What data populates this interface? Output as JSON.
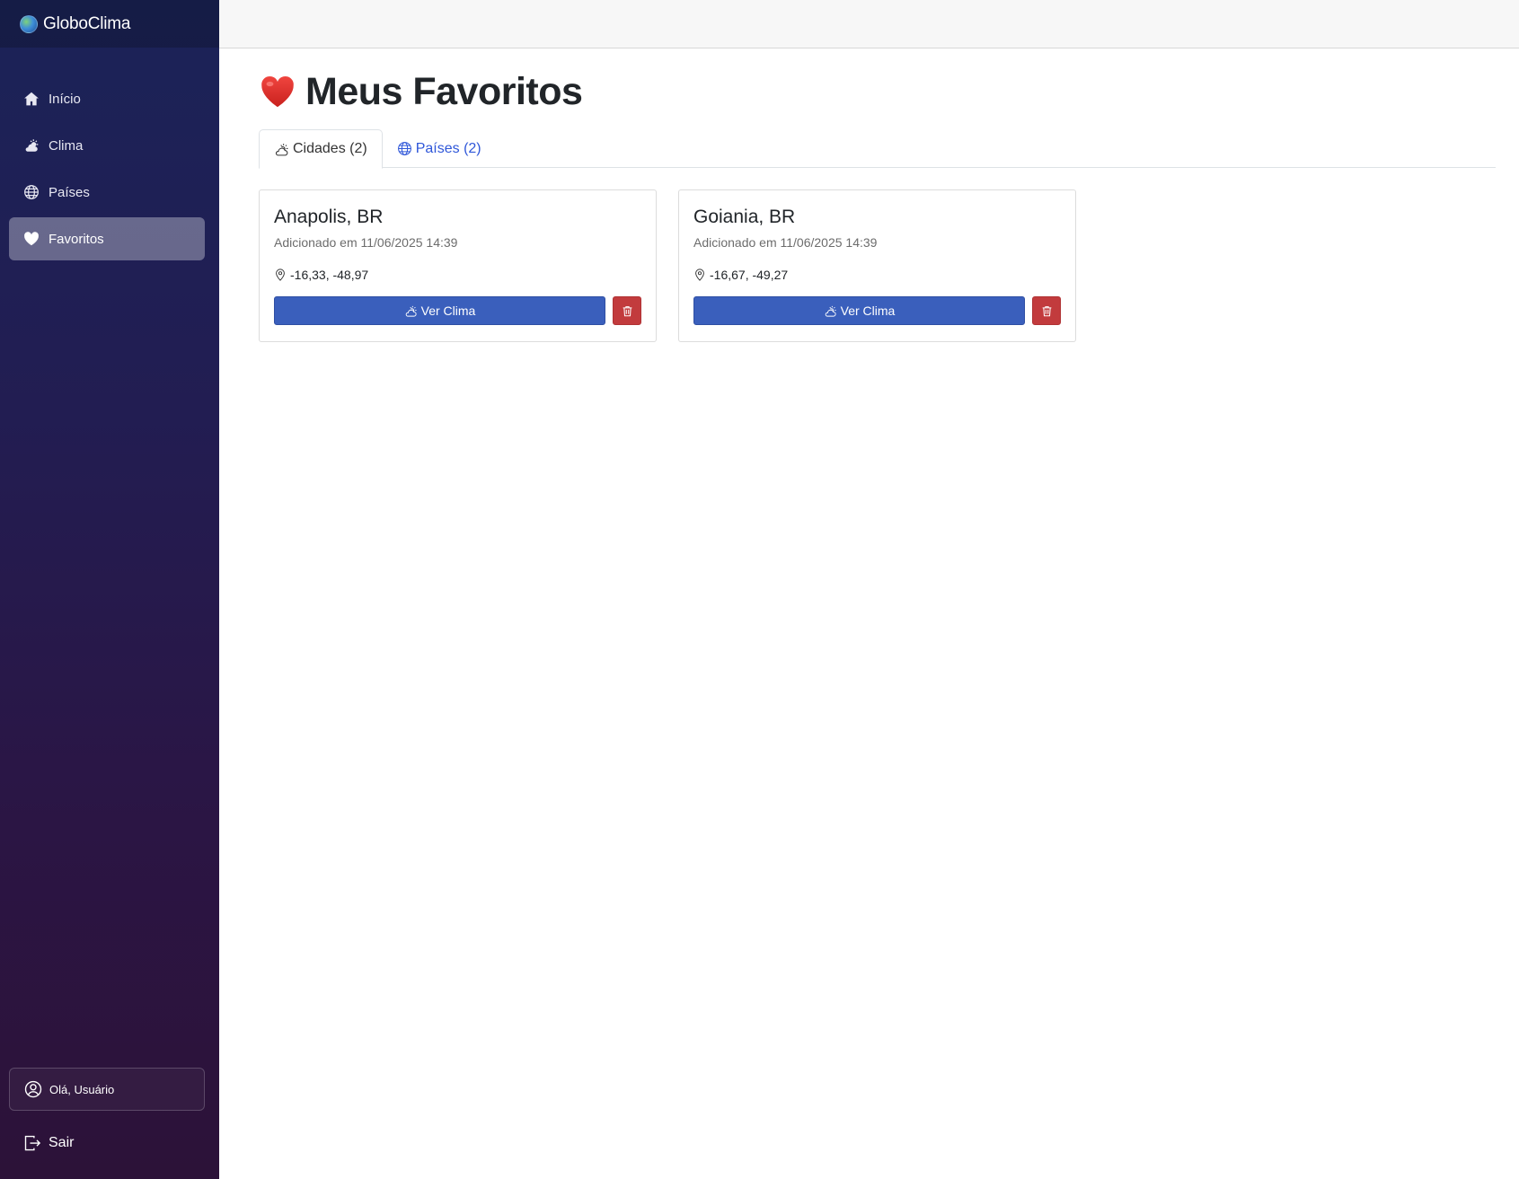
{
  "app": {
    "brand": "GloboClima"
  },
  "sidebar": {
    "items": [
      {
        "label": "Início",
        "icon": "home-icon"
      },
      {
        "label": "Clima",
        "icon": "cloud-sun-icon"
      },
      {
        "label": "Países",
        "icon": "globe-icon"
      },
      {
        "label": "Favoritos",
        "icon": "heart-icon",
        "active": true
      }
    ],
    "user_greeting": "Olá, Usuário",
    "logout_label": "Sair"
  },
  "main": {
    "title": "Meus Favoritos",
    "tabs": [
      {
        "label": "Cidades (2)",
        "icon": "cloud-sun-icon",
        "active": true
      },
      {
        "label": "Países (2)",
        "icon": "globe-icon",
        "active": false
      }
    ],
    "cards": [
      {
        "name": "Anapolis, BR",
        "added": "Adicionado em 11/06/2025 14:39",
        "coords": "-16,33, -48,97",
        "view_label": "Ver Clima"
      },
      {
        "name": "Goiania, BR",
        "added": "Adicionado em 11/06/2025 14:39",
        "coords": "-16,67, -49,27",
        "view_label": "Ver Clima"
      }
    ]
  },
  "colors": {
    "primary": "#3a5fbc",
    "danger": "#c23b3d",
    "link": "#2f57d9",
    "sidebar_top": "#1b2358",
    "sidebar_bottom": "#2c1238"
  }
}
